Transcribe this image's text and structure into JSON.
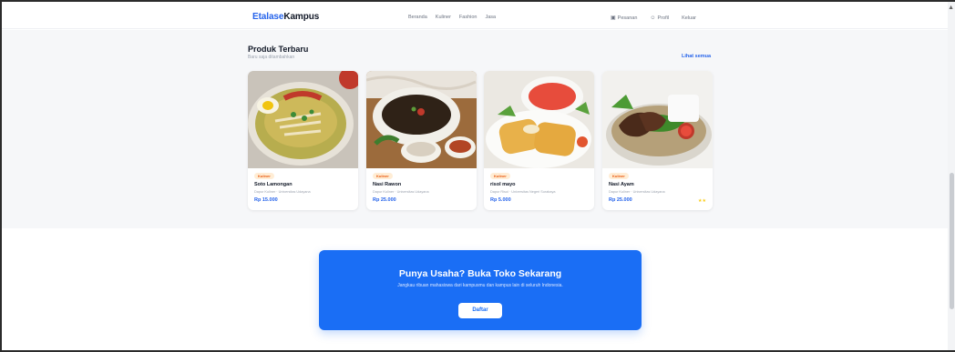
{
  "header": {
    "logo_part1": "Etalase",
    "logo_part2": "Kampus",
    "menu": [
      "Beranda",
      "Kuliner",
      "Fashion",
      "Jasa"
    ],
    "orders": "Pesanan",
    "profile": "Profil",
    "logout": "Keluar"
  },
  "section": {
    "title": "Produk Terbaru",
    "subtitle": "Baru saja ditambahkan",
    "see_all": "Lihat semua"
  },
  "products": [
    {
      "category": "Kuliner",
      "name": "Soto Lamongan",
      "location": "Dapur Kuliner · Universitas Udayana",
      "price": "Rp 15.000"
    },
    {
      "category": "Kuliner",
      "name": "Nasi Rawon",
      "location": "Dapur Kuliner · Universitas Udayana",
      "price": "Rp 25.000"
    },
    {
      "category": "Kuliner",
      "name": "risol mayo",
      "location": "Dapur Risol · Universitas Negeri Surabaya",
      "price": "Rp 5.000"
    },
    {
      "category": "Kuliner",
      "name": "Nasi Ayam",
      "location": "Dapur Kuliner · Universitas Udayana",
      "price": "Rp 25.000",
      "rating": "★★"
    }
  ],
  "cta": {
    "title": "Punya Usaha? Buka Toko Sekarang",
    "text": "Jangkau ribuan mahasiswa dari kampusmu dan kampus lain di seluruh Indonesia.",
    "button": "Daftar"
  },
  "colors": {
    "accent": "#1a6ef5",
    "brand": "#2563eb",
    "badge": "#ea580c"
  }
}
